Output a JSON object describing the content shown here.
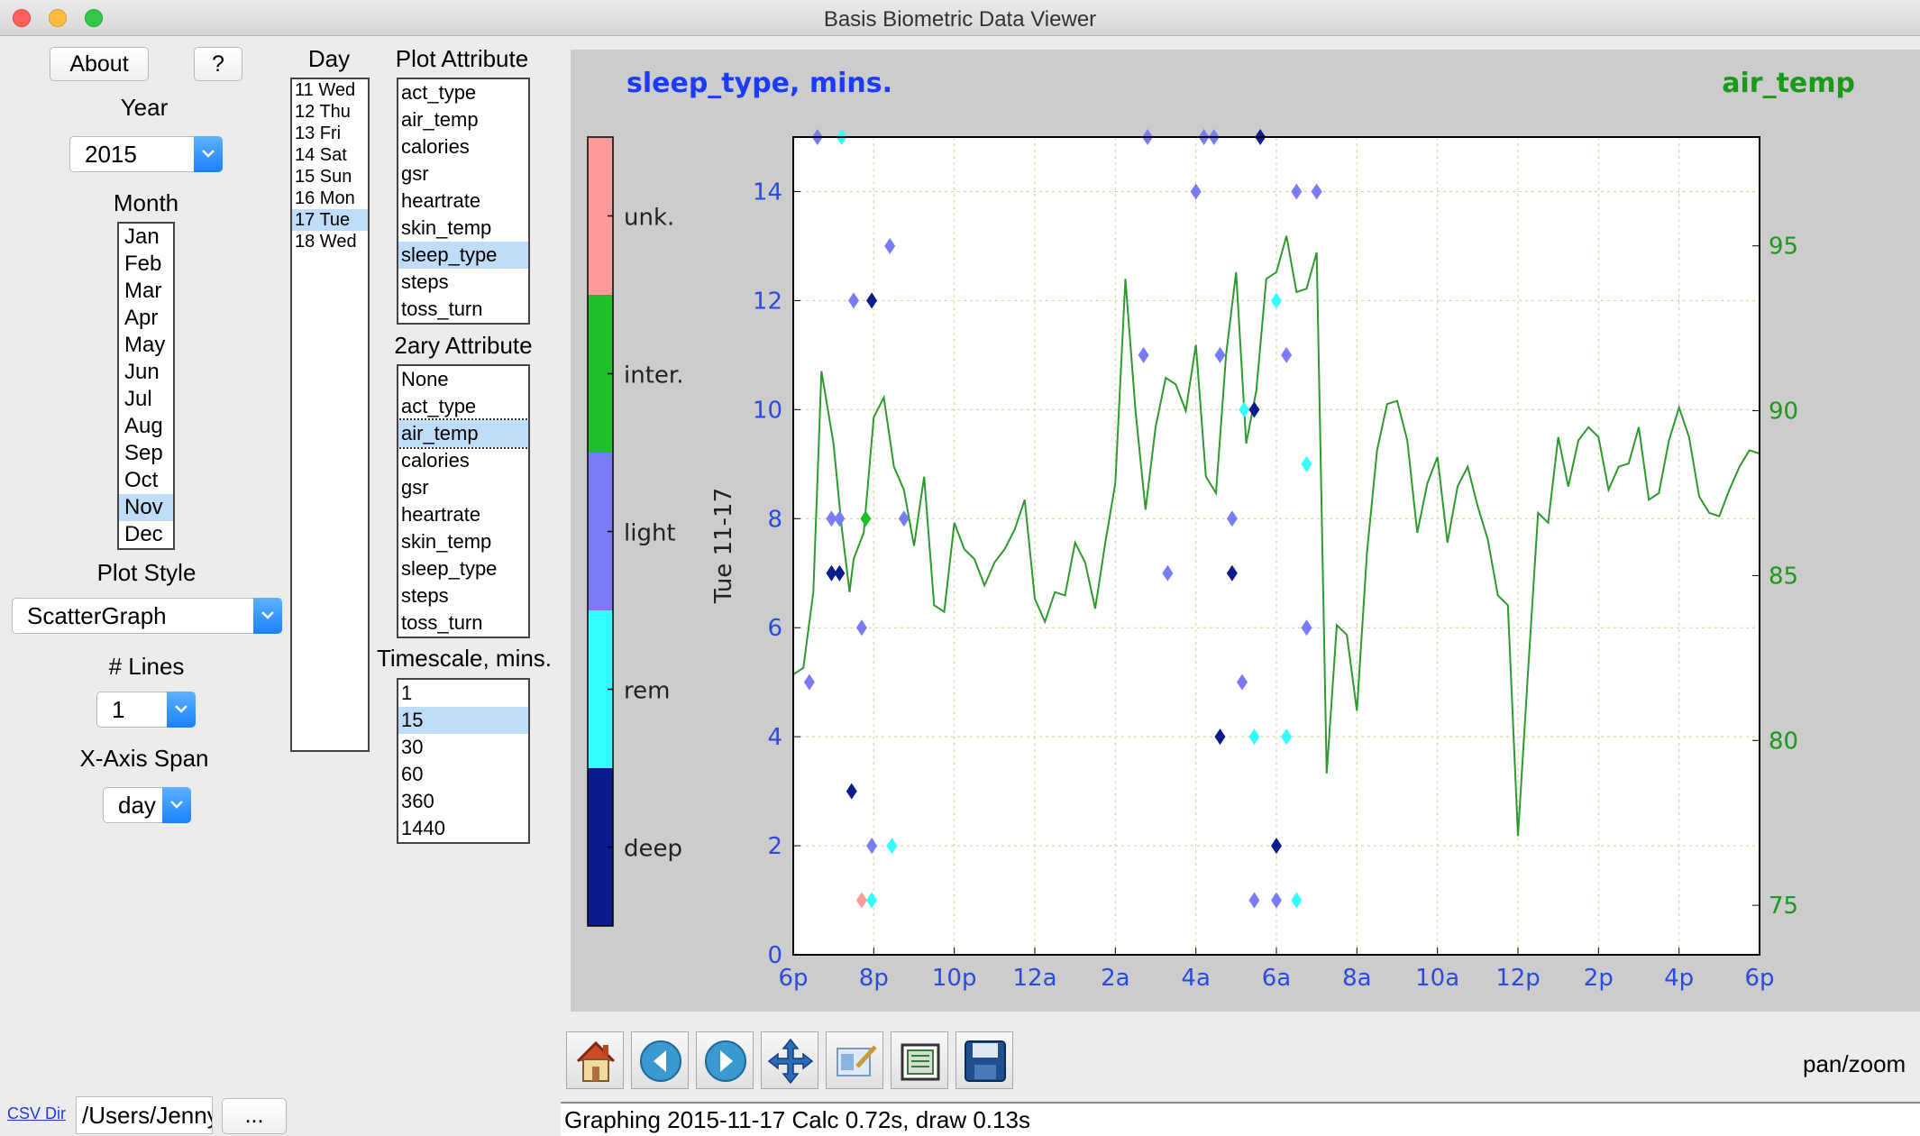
{
  "window": {
    "title": "Basis Biometric Data Viewer"
  },
  "buttons": {
    "about": "About",
    "help": "?",
    "browse": "..."
  },
  "year": {
    "label": "Year",
    "value": "2015"
  },
  "month": {
    "label": "Month",
    "items": [
      "Jan",
      "Feb",
      "Mar",
      "Apr",
      "May",
      "Jun",
      "Jul",
      "Aug",
      "Sep",
      "Oct",
      "Nov",
      "Dec"
    ],
    "selected": "Nov"
  },
  "plot_style": {
    "label": "Plot Style",
    "value": "ScatterGraph"
  },
  "lines": {
    "label": "# Lines",
    "value": "1"
  },
  "xspan": {
    "label": "X-Axis Span",
    "value": "day"
  },
  "csv": {
    "link": "CSV Dir",
    "path": "/Users/Jenny"
  },
  "day": {
    "label": "Day",
    "items": [
      "11 Wed",
      "12 Thu",
      "13 Fri",
      "14 Sat",
      "15 Sun",
      "16 Mon",
      "17 Tue",
      "18 Wed"
    ],
    "selected": "17 Tue"
  },
  "plot_attribute": {
    "label": "Plot Attribute",
    "items": [
      "act_type",
      "air_temp",
      "calories",
      "gsr",
      "heartrate",
      "skin_temp",
      "sleep_type",
      "steps",
      "toss_turn"
    ],
    "selected": "sleep_type"
  },
  "secondary_attribute": {
    "label": "2ary Attribute",
    "items": [
      "None",
      "act_type",
      "air_temp",
      "calories",
      "gsr",
      "heartrate",
      "skin_temp",
      "sleep_type",
      "steps",
      "toss_turn"
    ],
    "selected": "air_temp"
  },
  "timescale": {
    "label": "Timescale, mins.",
    "items": [
      "1",
      "15",
      "30",
      "60",
      "360",
      "1440"
    ],
    "selected": "15"
  },
  "toolbar": {
    "mode": "pan/zoom",
    "icons": [
      "home-icon",
      "back-icon",
      "forward-icon",
      "pan-icon",
      "zoom-icon",
      "configure-icon",
      "save-icon"
    ]
  },
  "status": {
    "text": "Graphing 2015-11-17 Calc 0.72s, draw 0.13s"
  },
  "colors": {
    "deep": "#0a1c8c",
    "rem": "#33ffff",
    "light": "#7a7cf5",
    "inter": "#1fbf2a",
    "unk": "#ff9a9a",
    "line": "#2e9a2e",
    "left_title": "#1a3cff",
    "right_title": "#1a9a1a"
  },
  "chart_data": {
    "type": "scatter",
    "title_left": "sleep_type, mins.",
    "title_right": "air_temp",
    "ylabel": "Tue 11-17",
    "x_ticks": [
      "6p",
      "8p",
      "10p",
      "12a",
      "2a",
      "4a",
      "6a",
      "8a",
      "10a",
      "12p",
      "2p",
      "4p",
      "6p"
    ],
    "xlim": [
      0,
      24
    ],
    "ylim": [
      0,
      15
    ],
    "y_ticks": [
      0,
      2,
      4,
      6,
      8,
      10,
      12,
      14
    ],
    "y2lim": [
      73.5,
      98.3
    ],
    "y2_ticks": [
      75,
      80,
      85,
      90,
      95
    ],
    "grid": true,
    "colorbar": {
      "labels": [
        "deep",
        "rem",
        "light",
        "inter.",
        "unk."
      ]
    },
    "scatter_points": [
      {
        "x": 0.6,
        "y": 15,
        "stage": "light"
      },
      {
        "x": 1.2,
        "y": 15,
        "stage": "rem"
      },
      {
        "x": 8.8,
        "y": 15,
        "stage": "light"
      },
      {
        "x": 10.2,
        "y": 15,
        "stage": "light"
      },
      {
        "x": 10.45,
        "y": 15,
        "stage": "light"
      },
      {
        "x": 11.6,
        "y": 15,
        "stage": "deep"
      },
      {
        "x": 10.0,
        "y": 14,
        "stage": "light"
      },
      {
        "x": 12.5,
        "y": 14,
        "stage": "light"
      },
      {
        "x": 13.0,
        "y": 14,
        "stage": "light"
      },
      {
        "x": 2.4,
        "y": 13,
        "stage": "light"
      },
      {
        "x": 1.5,
        "y": 12,
        "stage": "light"
      },
      {
        "x": 1.95,
        "y": 12,
        "stage": "deep"
      },
      {
        "x": 12.0,
        "y": 12,
        "stage": "rem"
      },
      {
        "x": 8.7,
        "y": 11,
        "stage": "light"
      },
      {
        "x": 10.6,
        "y": 11,
        "stage": "light"
      },
      {
        "x": 12.25,
        "y": 11,
        "stage": "light"
      },
      {
        "x": 11.2,
        "y": 10,
        "stage": "rem"
      },
      {
        "x": 11.45,
        "y": 10,
        "stage": "deep"
      },
      {
        "x": 12.75,
        "y": 9,
        "stage": "rem"
      },
      {
        "x": 0.95,
        "y": 8,
        "stage": "light"
      },
      {
        "x": 1.15,
        "y": 8,
        "stage": "light"
      },
      {
        "x": 1.8,
        "y": 8,
        "stage": "inter"
      },
      {
        "x": 2.75,
        "y": 8,
        "stage": "light"
      },
      {
        "x": 10.9,
        "y": 8,
        "stage": "light"
      },
      {
        "x": 0.95,
        "y": 7,
        "stage": "deep"
      },
      {
        "x": 1.15,
        "y": 7,
        "stage": "deep"
      },
      {
        "x": 9.3,
        "y": 7,
        "stage": "light"
      },
      {
        "x": 10.9,
        "y": 7,
        "stage": "deep"
      },
      {
        "x": 0.4,
        "y": 5,
        "stage": "light"
      },
      {
        "x": 11.15,
        "y": 5,
        "stage": "light"
      },
      {
        "x": 1.7,
        "y": 6,
        "stage": "light"
      },
      {
        "x": 12.75,
        "y": 6,
        "stage": "light"
      },
      {
        "x": 10.6,
        "y": 4,
        "stage": "deep"
      },
      {
        "x": 11.45,
        "y": 4,
        "stage": "rem"
      },
      {
        "x": 12.25,
        "y": 4,
        "stage": "rem"
      },
      {
        "x": 1.45,
        "y": 3,
        "stage": "deep"
      },
      {
        "x": 1.95,
        "y": 2,
        "stage": "light"
      },
      {
        "x": 2.45,
        "y": 2,
        "stage": "rem"
      },
      {
        "x": 12.0,
        "y": 2,
        "stage": "deep"
      },
      {
        "x": 1.7,
        "y": 1,
        "stage": "unk"
      },
      {
        "x": 1.95,
        "y": 1,
        "stage": "rem"
      },
      {
        "x": 11.45,
        "y": 1,
        "stage": "light"
      },
      {
        "x": 12.0,
        "y": 1,
        "stage": "light"
      },
      {
        "x": 12.5,
        "y": 1,
        "stage": "rem"
      }
    ],
    "line_series": {
      "name": "air_temp",
      "x": [
        0,
        0.25,
        0.5,
        0.7,
        1.0,
        1.2,
        1.4,
        1.5,
        1.75,
        2.0,
        2.25,
        2.5,
        2.75,
        3.0,
        3.25,
        3.5,
        3.75,
        4.0,
        4.25,
        4.5,
        4.75,
        5.0,
        5.25,
        5.5,
        5.75,
        6.0,
        6.25,
        6.5,
        6.75,
        7.0,
        7.25,
        7.5,
        7.75,
        8.0,
        8.25,
        8.5,
        8.75,
        9.0,
        9.25,
        9.5,
        9.75,
        10.0,
        10.25,
        10.5,
        10.75,
        11.0,
        11.25,
        11.5,
        11.75,
        12.0,
        12.25,
        12.5,
        12.75,
        13.0,
        13.25,
        13.5,
        13.75,
        14.0,
        14.25,
        14.5,
        14.75,
        15.0,
        15.25,
        15.5,
        15.75,
        16.0,
        16.25,
        16.5,
        16.75,
        17.0,
        17.25,
        17.5,
        17.75,
        18.0,
        18.25,
        18.5,
        18.75,
        19.0,
        19.25,
        19.5,
        19.75,
        20.0,
        20.25,
        20.5,
        20.75,
        21.0,
        21.25,
        21.5,
        21.75,
        22.0,
        22.25,
        22.5,
        22.75,
        23.0,
        23.25,
        23.5,
        23.75,
        24.0
      ],
      "y": [
        82.0,
        82.2,
        84.5,
        91.2,
        89.0,
        86.5,
        84.5,
        85.5,
        86.3,
        89.8,
        90.4,
        88.3,
        87.6,
        85.9,
        88.0,
        84.1,
        83.9,
        86.6,
        85.8,
        85.5,
        84.7,
        85.4,
        85.8,
        86.4,
        87.3,
        84.3,
        83.6,
        84.5,
        84.4,
        86.0,
        85.4,
        84.0,
        86.0,
        87.8,
        94.0,
        90.0,
        87.0,
        89.5,
        91.0,
        90.8,
        90.0,
        92.0,
        88.0,
        87.5,
        91.7,
        94.2,
        89.0,
        90.6,
        94.0,
        94.2,
        95.3,
        93.6,
        93.7,
        94.8,
        79.0,
        83.5,
        83.2,
        80.9,
        85.7,
        88.8,
        90.2,
        90.3,
        89.1,
        86.3,
        87.8,
        88.6,
        86.0,
        87.7,
        88.3,
        87.1,
        86.1,
        84.4,
        84.1,
        77.1,
        82.1,
        86.9,
        86.6,
        89.2,
        87.7,
        89.1,
        89.5,
        89.2,
        87.6,
        88.3,
        88.4,
        89.5,
        87.3,
        87.5,
        89.1,
        90.1,
        89.2,
        87.4,
        86.9,
        86.8,
        87.6,
        88.3,
        88.8,
        88.7
      ]
    }
  }
}
